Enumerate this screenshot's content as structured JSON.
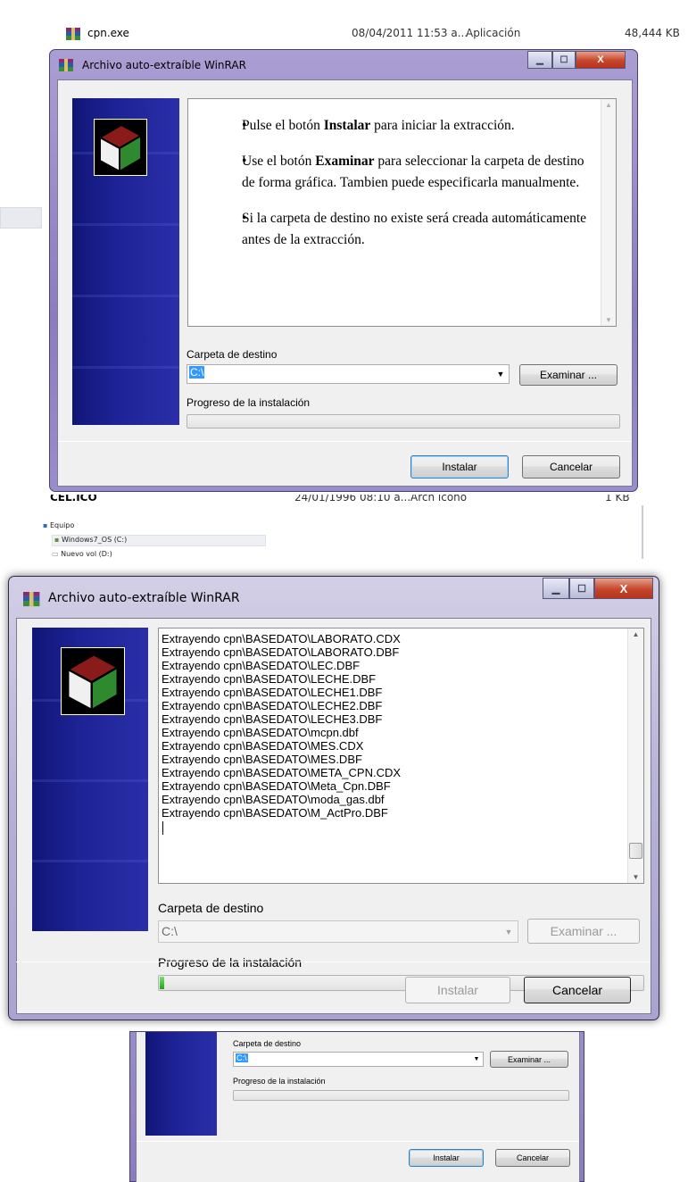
{
  "explorer": {
    "top_file": {
      "name": "cpn.exe",
      "date": "08/04/2011 11:53 a...",
      "type": "Aplicación",
      "size": "48,444 KB"
    },
    "middle_file": {
      "name": "CEL.ICO",
      "date": "24/01/1996 08:10 a...",
      "type": "Arch icono",
      "size": "1 KB"
    },
    "nav": [
      "Equipo",
      "Windows7_OS (C:)",
      "Nuevo vol (D:)"
    ]
  },
  "dialog": {
    "title": "Archivo auto-extraíble WinRAR",
    "instructions": [
      {
        "pre": "Pulse el botón ",
        "bold": "Instalar",
        "post": " para iniciar la extracción."
      },
      {
        "pre": "Use el botón ",
        "bold": "Examinar",
        "post": " para seleccionar la carpeta de destino de forma gráfica. Tambien puede especificarla manualmente."
      },
      {
        "pre": "Si la carpeta de destino no existe será creada automáticamente antes de la extracción.",
        "bold": "",
        "post": ""
      }
    ],
    "dest_label": "Carpeta de destino",
    "dest_value": "C:\\",
    "browse_label": "Examinar ...",
    "progress_label": "Progreso de la instalación",
    "install_label": "Instalar",
    "cancel_label": "Cancelar",
    "min_glyph": "▁",
    "max_glyph": "☐",
    "close_glyph": "X",
    "scroll_up": "▲",
    "scroll_down": "▼",
    "combo_arrow": "▼"
  },
  "extraction_log": [
    "Extrayendo cpn\\BASEDATO\\LABORATO.CDX",
    "Extrayendo cpn\\BASEDATO\\LABORATO.DBF",
    "Extrayendo cpn\\BASEDATO\\LEC.DBF",
    "Extrayendo cpn\\BASEDATO\\LECHE.DBF",
    "Extrayendo cpn\\BASEDATO\\LECHE1.DBF",
    "Extrayendo cpn\\BASEDATO\\LECHE2.DBF",
    "Extrayendo cpn\\BASEDATO\\LECHE3.DBF",
    "Extrayendo cpn\\BASEDATO\\mcpn.dbf",
    "Extrayendo cpn\\BASEDATO\\MES.CDX",
    "Extrayendo cpn\\BASEDATO\\MES.DBF",
    "Extrayendo cpn\\BASEDATO\\META_CPN.CDX",
    "Extrayendo cpn\\BASEDATO\\Meta_Cpn.DBF",
    "Extrayendo cpn\\BASEDATO\\moda_gas.dbf",
    "Extrayendo cpn\\BASEDATO\\M_ActPro.DBF"
  ],
  "progress_fraction": 0.01,
  "colors": {
    "side_panel": "#1d2295",
    "default_button": "#3c7fb1",
    "progress_fill": "#1aa51a"
  }
}
